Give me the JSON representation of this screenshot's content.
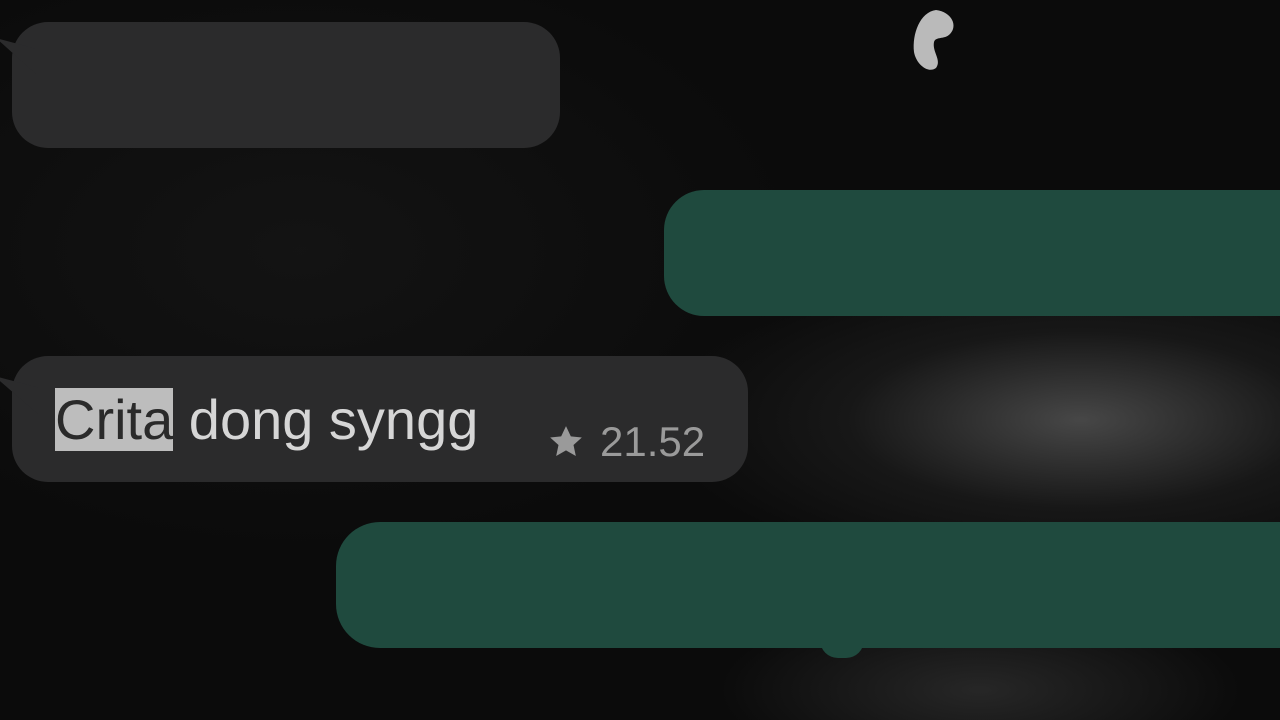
{
  "chat": {
    "messages": [
      {
        "direction": "incoming",
        "text": ""
      },
      {
        "direction": "outgoing",
        "text": ""
      },
      {
        "direction": "incoming",
        "selected_text": "Crita",
        "remaining_text": " dong syngg",
        "starred": true,
        "time": "21.52"
      },
      {
        "direction": "outgoing",
        "text": ""
      }
    ]
  },
  "icons": {
    "star": "star-icon"
  },
  "colors": {
    "background": "#0b0b0b",
    "incoming_bubble": "#2b2b2c",
    "outgoing_bubble": "#1f4a3e",
    "selection_highlight": "#bdbdbd",
    "meta_text": "#9a9a9a"
  }
}
